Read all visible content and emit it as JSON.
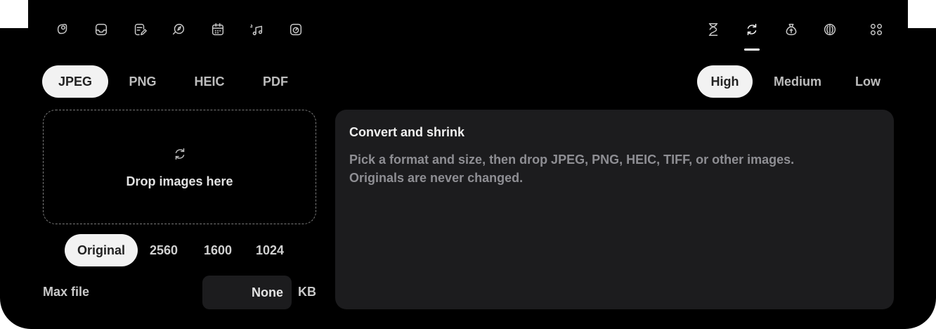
{
  "formats": [
    "JPEG",
    "PNG",
    "HEIC",
    "PDF"
  ],
  "selected_format": "JPEG",
  "quality": [
    "High",
    "Medium",
    "Low"
  ],
  "selected_quality": "High",
  "dropzone": {
    "label": "Drop images here"
  },
  "sizes": [
    "Original",
    "2560",
    "1600",
    "1024"
  ],
  "selected_size": "Original",
  "max_file": {
    "label": "Max file",
    "value": "None",
    "unit": "KB"
  },
  "info": {
    "title": "Convert and shrink",
    "body_line1": "Pick a format and size, then drop JPEG, PNG, HEIC, TIFF, or other images.",
    "body_line2": "Originals are never changed."
  },
  "toolbar_left_icons": [
    "hand-coin-icon",
    "inbox-icon",
    "note-edit-icon",
    "compass-icon",
    "calendar-icon",
    "music-notes-icon",
    "speedometer-icon"
  ],
  "toolbar_right_icons": [
    "hourglass-icon",
    "refresh-icon",
    "money-bag-icon",
    "aperture-icon",
    "grid-icon"
  ],
  "active_tab_icon": "refresh-icon",
  "colors": {
    "window_bg": "#000000",
    "panel_bg": "#1c1c1e",
    "pill_selected_bg": "#f2f2f2"
  }
}
